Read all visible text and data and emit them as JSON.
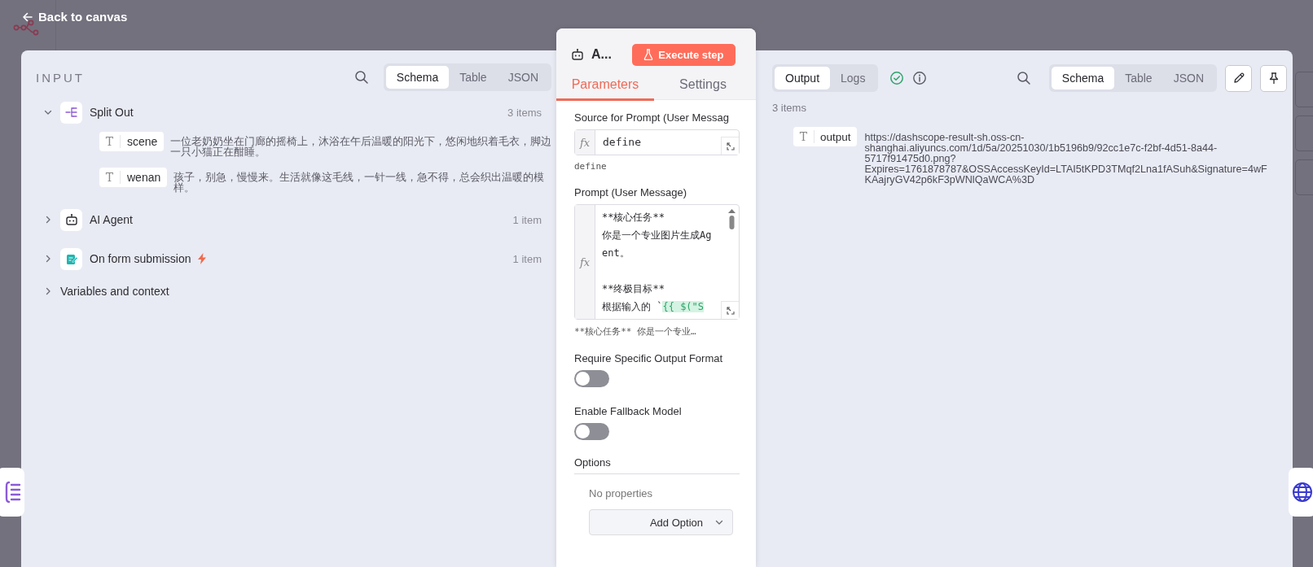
{
  "header": {
    "back_label": "Back to canvas"
  },
  "input": {
    "title": "INPUT",
    "view_tabs": [
      {
        "label": "Schema",
        "selected": true
      },
      {
        "label": "Table",
        "selected": false
      },
      {
        "label": "JSON",
        "selected": false
      }
    ],
    "nodes": [
      {
        "name": "Split Out",
        "kind": "split",
        "count": "3 items",
        "expanded": true,
        "trigger": false,
        "fields": [
          {
            "type_label": "T",
            "name": "scene",
            "value": "一位老奶奶坐在门廊的摇椅上，沐浴在午后温暖的阳光下，悠闲地织着毛衣，脚边一只小猫正在酣睡。"
          },
          {
            "type_label": "T",
            "name": "wenan",
            "value": "孩子，别急，慢慢来。生活就像这毛线，一针一线，急不得，总会织出温暖的模样。"
          }
        ]
      },
      {
        "name": "AI Agent",
        "kind": "robot",
        "count": "1 item",
        "expanded": false,
        "trigger": false
      },
      {
        "name": "On form submission",
        "kind": "form",
        "count": "1 item",
        "expanded": false,
        "trigger": true
      }
    ],
    "context": {
      "label": "Variables and context",
      "expanded": false
    }
  },
  "node": {
    "title": "A...",
    "execute_label": "Execute step",
    "tabs": [
      {
        "label": "Parameters",
        "selected": true
      },
      {
        "label": "Settings",
        "selected": false
      }
    ],
    "params": [
      {
        "kind": "expression",
        "label": "Source for Prompt (User Messag",
        "fx_label": "fx",
        "value": "define",
        "preview": "define"
      },
      {
        "kind": "textarea",
        "label": "Prompt (User Message)",
        "fx_label": "fx",
        "value": "**核心任务**\n你是一个专业图片生成Agent。\n\n**终极目标**\n根据输入的 `",
        "expression": "{{ $(\"S",
        "preview": "**核心任务** 你是一个专业…"
      },
      {
        "kind": "toggle",
        "label": "Require Specific Output Format",
        "on": false
      },
      {
        "kind": "toggle",
        "label": "Enable Fallback Model",
        "on": false
      },
      {
        "kind": "collection",
        "label": "Options",
        "empty_text": "No properties",
        "button": "Add Option"
      }
    ]
  },
  "output": {
    "tabs": [
      {
        "label": "Output",
        "selected": true
      },
      {
        "label": "Logs",
        "selected": false
      }
    ],
    "view_tabs": [
      {
        "label": "Schema",
        "selected": true
      },
      {
        "label": "Table",
        "selected": false
      },
      {
        "label": "JSON",
        "selected": false
      }
    ],
    "count": "3 items",
    "fields": [
      {
        "type_label": "T",
        "name": "output",
        "value": "https://dashscope-result-sh.oss-cn-shanghai.aliyuncs.com/1d/5a/20251030/1b5196b9/92cc1e7c-f2bf-4d51-8a44-5717f91475d0.png?Expires=1761878787&OSSAccessKeyId=LTAI5tKPD3TMqf2Lna1fASuh&Signature=4wFKAajryGV42p6kF3pWNlQaWCA%3D"
      }
    ]
  }
}
